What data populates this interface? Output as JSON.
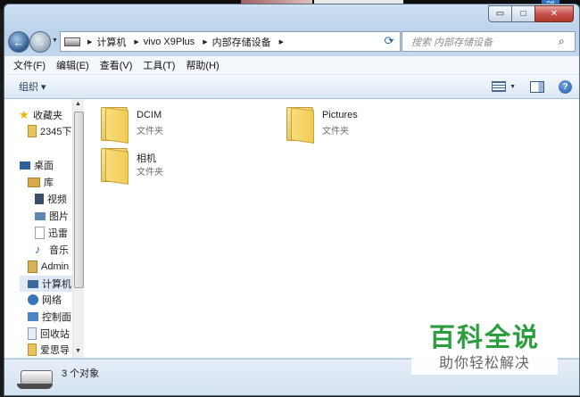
{
  "window": {
    "caption_buttons": {
      "minimize": "▭",
      "maximize": "□",
      "close": "✕"
    },
    "address_path": [
      "计算机",
      "vivo X9Plus",
      "内部存储设备"
    ],
    "search_placeholder": "搜索 内部存储设备",
    "corner_badge": "08"
  },
  "menu": [
    "文件(F)",
    "编辑(E)",
    "查看(V)",
    "工具(T)",
    "帮助(H)"
  ],
  "toolbar": {
    "organize": "组织 ▾"
  },
  "nav": {
    "items": [
      {
        "label": "收藏夹",
        "icon": "star-icon",
        "color": "#f0b400"
      },
      {
        "label": "2345下",
        "icon": "folder-icon",
        "color": "#e8c35a"
      },
      {
        "label": "桌面",
        "icon": "desktop-icon",
        "color": "#2f5f98"
      },
      {
        "label": "库",
        "icon": "library-icon",
        "color": "#d9a84a"
      },
      {
        "label": "视频",
        "icon": "video-icon",
        "color": "#3b4e68"
      },
      {
        "label": "图片",
        "icon": "pictures-icon",
        "color": "#5f87b4"
      },
      {
        "label": "迅雷",
        "icon": "document-icon",
        "color": "#8ba4c3"
      },
      {
        "label": "音乐",
        "icon": "music-icon",
        "color": "#2e6fc0"
      },
      {
        "label": "Admin",
        "icon": "user-folder-icon",
        "color": "#d8b25a"
      },
      {
        "label": "计算机",
        "icon": "computer-icon",
        "color": "#3c6aa0"
      },
      {
        "label": "网络",
        "icon": "network-icon",
        "color": "#3a75b9"
      },
      {
        "label": "控制面",
        "icon": "control-panel-icon",
        "color": "#4a86c6"
      },
      {
        "label": "回收站",
        "icon": "recycle-bin-icon",
        "color": "#7b9bc0"
      },
      {
        "label": "爱思导",
        "icon": "folder-icon",
        "color": "#e8c35a"
      }
    ]
  },
  "files": [
    {
      "name": "DCIM",
      "type": "文件夹"
    },
    {
      "name": "Pictures",
      "type": "文件夹"
    },
    {
      "name": "相机",
      "type": "文件夹"
    }
  ],
  "status": {
    "count": "3 个对象"
  },
  "watermark": {
    "title": "百科全说",
    "subtitle": "助你轻松解决"
  }
}
